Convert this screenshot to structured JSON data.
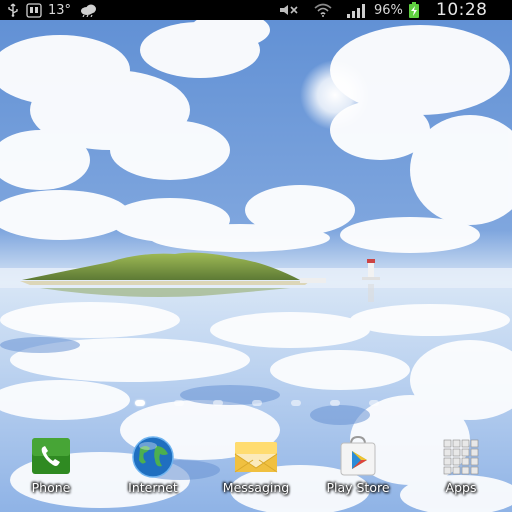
{
  "status_bar": {
    "temperature": "13°",
    "battery_percent": "96%",
    "time": "10:28",
    "left_icons": [
      "usb-icon",
      "sd-card-icon",
      "weather-cloud-icon"
    ],
    "right_icons": [
      "mute-icon",
      "wifi-icon",
      "signal-icon",
      "battery-charging-icon"
    ]
  },
  "home": {
    "page_count": 7,
    "active_page": 0
  },
  "dock": {
    "apps": [
      {
        "label": "Phone",
        "icon": "phone-icon"
      },
      {
        "label": "Internet",
        "icon": "globe-icon"
      },
      {
        "label": "Messaging",
        "icon": "envelope-icon"
      },
      {
        "label": "Play Store",
        "icon": "play-store-icon"
      },
      {
        "label": "Apps",
        "icon": "apps-grid-icon"
      }
    ]
  },
  "colors": {
    "sky": "#6f9ad8",
    "cloud": "#ffffff",
    "island": "#8fa84a",
    "status_bar": "#000000",
    "phone_green": "#3a9a2a",
    "globe_blue": "#1f6fc0",
    "envelope_yellow": "#f0c040"
  }
}
